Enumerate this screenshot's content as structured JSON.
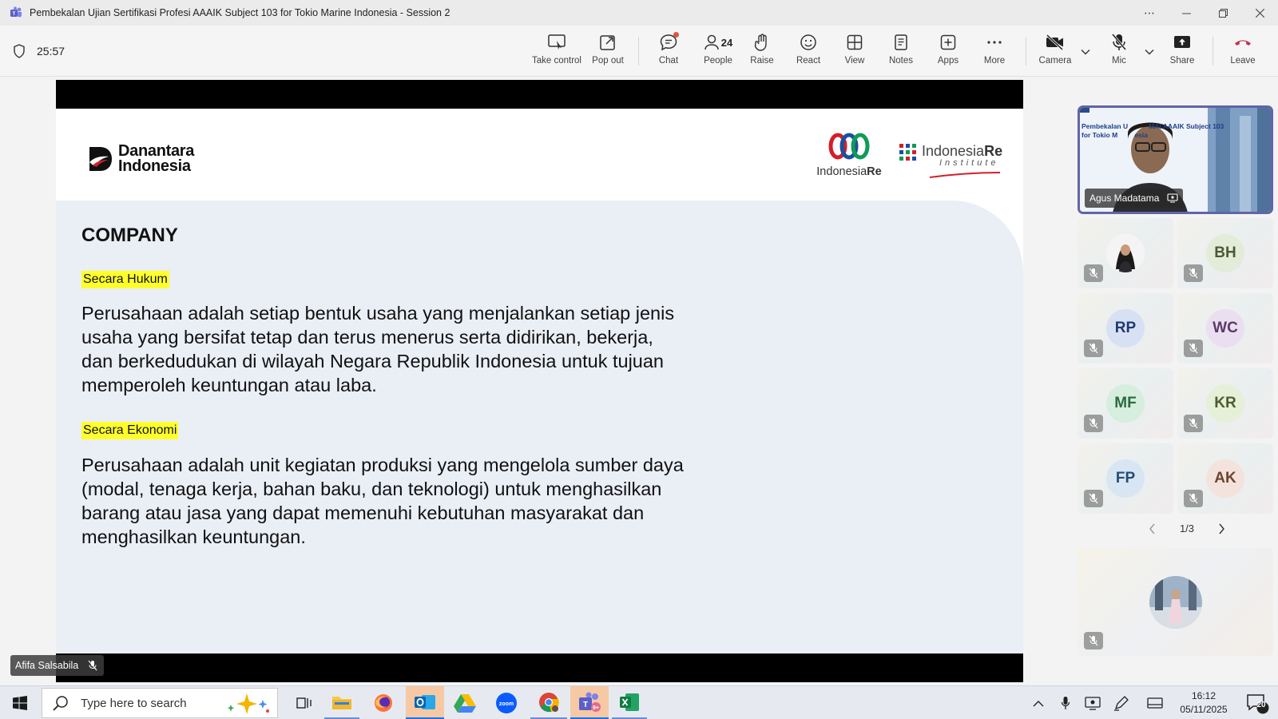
{
  "window": {
    "title": "Pembekalan Ujian Sertifikasi Profesi AAAIK Subject 103 for Tokio Marine Indonesia - Session 2",
    "controls": [
      "more-options",
      "minimize",
      "restore",
      "close"
    ]
  },
  "toolbar": {
    "timer": "25:57",
    "buttons": {
      "take_control": "Take control",
      "pop_out": "Pop out",
      "chat": "Chat",
      "people": "People",
      "people_count": "24",
      "raise": "Raise",
      "react": "React",
      "view": "View",
      "notes": "Notes",
      "apps": "Apps",
      "more": "More",
      "camera": "Camera",
      "mic": "Mic",
      "share": "Share",
      "leave": "Leave"
    },
    "colors": {
      "leave": "#c4314b",
      "chat_badge": "#e0543d"
    }
  },
  "slide": {
    "logo_left_line1": "Danantara",
    "logo_left_line2": "Indonesia",
    "logo_mid_a": "Indonesia",
    "logo_mid_b": "Re",
    "logo_right_a": "Indonesia",
    "logo_right_b": "Re",
    "logo_right_sub": "Institute",
    "heading": "COMPANY",
    "section1_label": "Secara Hukum",
    "section1_text": "Perusahaan adalah setiap bentuk usaha yang menjalankan setiap jenis usaha yang bersifat tetap dan terus menerus serta didirikan, bekerja, dan berkedudukan di wilayah Negara Republik Indonesia untuk tujuan memperoleh keuntungan atau laba.",
    "section2_label": "Secara Ekonomi",
    "section2_text": "Perusahaan adalah unit kegiatan produksi yang mengelola sumber daya (modal, tenaga kerja, bahan baku, dan teknologi) untuk menghasilkan barang atau jasa yang dapat memenuhi kebutuhan masyarakat dan menghasilkan keuntungan.",
    "highlight_color": "#ffff2b"
  },
  "presenter_tag": "Afifa Salsabila",
  "speaker": {
    "name": "Agus Madatama",
    "slide_text_a": "Pembekalan U",
    "slide_text_b": "MAI AAAIK Subject 103",
    "slide_text_c": "for Tokio M",
    "slide_text_d": "esia"
  },
  "participants": [
    {
      "initials": "",
      "type": "photo",
      "color": "#ffffff"
    },
    {
      "initials": "BH",
      "color": "#e3ecd9",
      "text_color": "#4a5a35"
    },
    {
      "initials": "RP",
      "color": "#d7e1f3",
      "text_color": "#1f3a72"
    },
    {
      "initials": "WC",
      "color": "#eadff0",
      "text_color": "#5a3a6a"
    },
    {
      "initials": "MF",
      "color": "#d5eedd",
      "text_color": "#2a6a3e"
    },
    {
      "initials": "KR",
      "color": "#e6efd8",
      "text_color": "#4c5d2e"
    },
    {
      "initials": "FP",
      "color": "#d8e6f3",
      "text_color": "#264c72"
    },
    {
      "initials": "AK",
      "color": "#f3e3dc",
      "text_color": "#6d4432"
    }
  ],
  "pager": "1/3",
  "taskbar": {
    "search_placeholder": "Type here to search",
    "time": "16:12",
    "date": "05/11/2025",
    "notifications": "20"
  }
}
